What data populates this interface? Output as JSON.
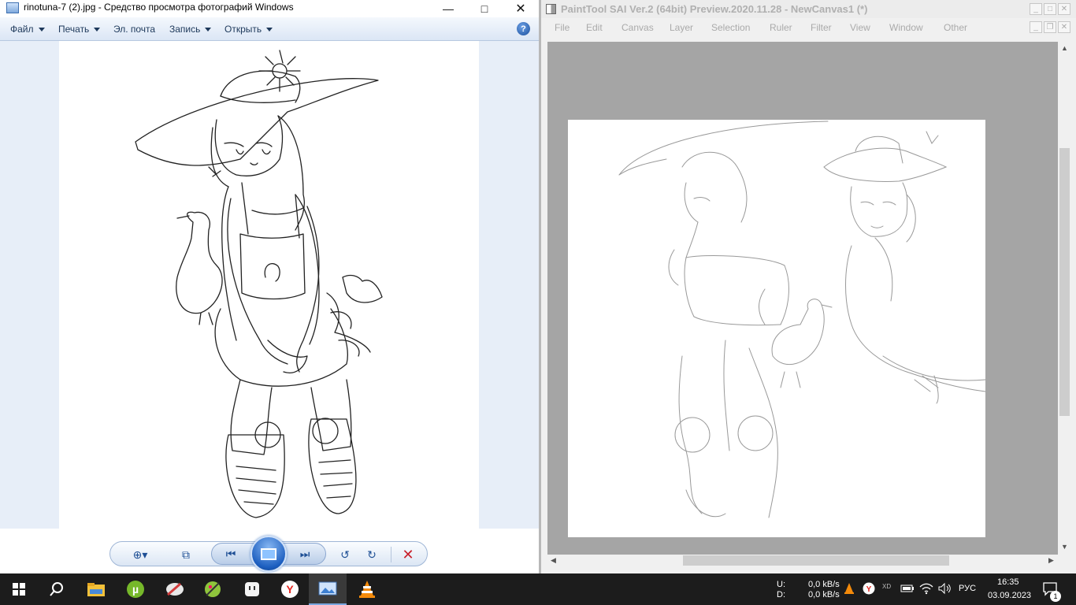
{
  "viewer": {
    "title": "rinotuna-7 (2).jpg - Средство просмотра фотографий Windows",
    "menu": {
      "file": "Файл",
      "print": "Печать",
      "email": "Эл. почта",
      "burn": "Запись",
      "open": "Открыть"
    },
    "help_glyph": "?"
  },
  "sai": {
    "title": "PaintTool SAI Ver.2 (64bit) Preview.2020.11.28 - NewCanvas1 (*)",
    "menu": [
      "File",
      "Edit",
      "Canvas",
      "Layer",
      "Selection",
      "Ruler",
      "Filter",
      "View",
      "Window",
      "Other"
    ]
  },
  "taskbar": {
    "net_up_label": "U:",
    "net_down_label": "D:",
    "net_up": "0,0 kB/s",
    "net_down": "0,0 kB/s",
    "language": "РУС",
    "time": "16:35",
    "date": "03.09.2023",
    "notifications": "1"
  },
  "colors": {
    "viewer_accent": "#1e4f95",
    "taskbar": "#1c1c1c",
    "sai_workspace": "#a5a5a5"
  }
}
